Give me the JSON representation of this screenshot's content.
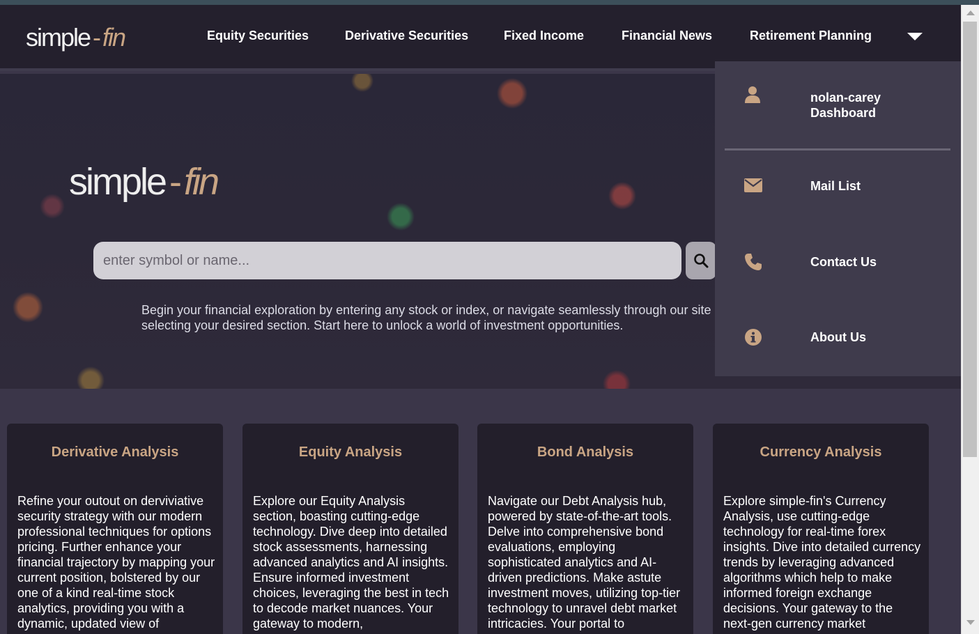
{
  "brand": {
    "logo_main": "simple",
    "logo_dash": "-",
    "logo_accent": "fin",
    "accent_color": "#c9a584"
  },
  "nav": {
    "items": [
      {
        "label": "Equity Securities"
      },
      {
        "label": "Derivative Securities"
      },
      {
        "label": "Fixed Income"
      },
      {
        "label": "Financial News"
      },
      {
        "label": "Retirement Planning"
      }
    ],
    "caret_icon": "caret-down-icon"
  },
  "hero": {
    "search_placeholder": "enter symbol or name...",
    "search_icon": "search-icon",
    "intro_text": "Begin your financial exploration by entering any stock or index, or navigate seamlessly through our site by selecting your desired section. Start here to unlock a world of investment opportunities."
  },
  "dropdown": {
    "items": [
      {
        "icon": "user-icon",
        "label": "nolan-carey Dashboard"
      },
      {
        "icon": "mail-icon",
        "label": "Mail List"
      },
      {
        "icon": "phone-icon",
        "label": "Contact Us"
      },
      {
        "icon": "info-icon",
        "label": "About Us"
      }
    ]
  },
  "cards": [
    {
      "title": "Derivative Analysis",
      "body": "Refine your outout on derviviative security strategy with our modern professional techniques for options pricing. Further enhance your financial trajectory by mapping your current position, bolstered by our one of a kind real-time stock analytics, providing you with a dynamic, updated view of"
    },
    {
      "title": "Equity Analysis",
      "body": "Explore our Equity Analysis section, boasting cutting-edge technology. Dive deep into detailed stock assessments, harnessing advanced analytics and AI insights. Ensure informed investment choices, leveraging the best in tech to decode market nuances. Your gateway to modern,"
    },
    {
      "title": "Bond Analysis",
      "body": "Navigate our Debt Analysis hub, powered by state-of-the-art tools. Delve into comprehensive bond evaluations, employing sophisticated analytics and AI-driven predictions. Make astute investment moves, utilizing top-tier technology to unravel debt market intricacies. Your portal to"
    },
    {
      "title": "Currency Analysis",
      "body": "Explore simple-fin's Currency Analysis, use cutting-edge technology for real-time forex insights. Dive into detailed currency trends by leveraging advanced algorithms which help to make informed foreign exchange decisions. Your gateway to the next-gen currency market"
    }
  ]
}
